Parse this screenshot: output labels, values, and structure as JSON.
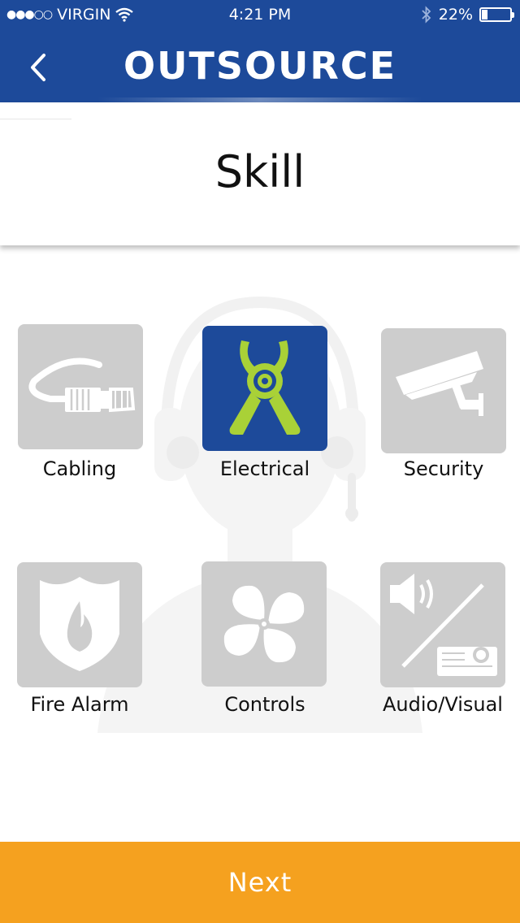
{
  "status_bar": {
    "carrier": "VIRGIN",
    "time": "4:21 PM",
    "battery": "22%",
    "battery_level": 0.22
  },
  "header": {
    "logo_text": "OUTSOURCE",
    "back_icon": "chevron-left-icon",
    "background_color": "#1d4a9a"
  },
  "page": {
    "title": "Skill"
  },
  "skills": [
    {
      "label": "Cabling",
      "icon": "cable-icon",
      "selected": false
    },
    {
      "label": "Electrical",
      "icon": "pliers-icon",
      "selected": true
    },
    {
      "label": "Security",
      "icon": "security-camera-icon",
      "selected": false
    },
    {
      "label": "Fire Alarm",
      "icon": "fire-shield-icon",
      "selected": false
    },
    {
      "label": "Controls",
      "icon": "fan-icon",
      "selected": false
    },
    {
      "label": "Audio/Visual",
      "icon": "speaker-projector-icon",
      "selected": false
    }
  ],
  "colors": {
    "selected_tile": "#1d4a9a",
    "unselected_tile": "#cdcdcd",
    "pliers_accent": "#a9d137",
    "next_button": "#f5a11f"
  },
  "footer": {
    "next_label": "Next"
  }
}
